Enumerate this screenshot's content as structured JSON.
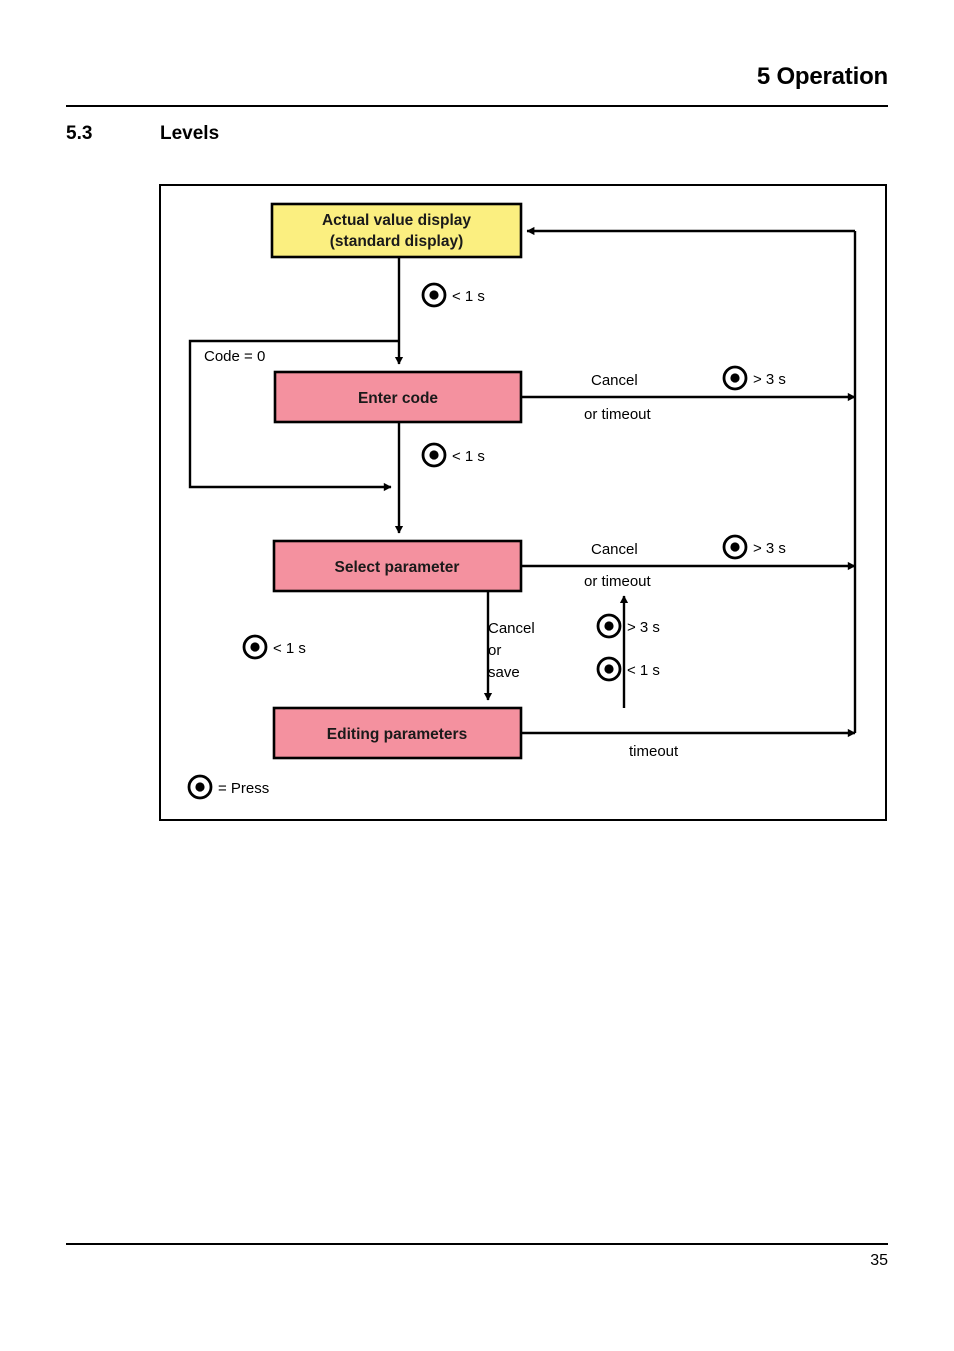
{
  "header": {
    "chapter_title": "5 Operation"
  },
  "section": {
    "number": "5.3",
    "title": "Levels"
  },
  "diagram": {
    "nodes": {
      "actual_value": {
        "line1": "Actual value display",
        "line2": "(standard display)",
        "color": "#FBEF80"
      },
      "enter_code": {
        "label": "Enter code",
        "color": "#F4919F"
      },
      "select_parameter": {
        "label": "Select parameter",
        "color": "#F4919F"
      },
      "editing_parameters": {
        "label": "Editing parameters",
        "color": "#F4919F"
      }
    },
    "edge_labels": {
      "press_short_1": "< 1 s",
      "press_short_2": "< 1 s",
      "press_short_3": "< 1 s",
      "press_short_4": "< 1 s",
      "press_long_1": "> 3 s",
      "press_long_2": "> 3 s",
      "press_long_3": "> 3 s",
      "code_zero": "Code = 0",
      "cancel_1": "Cancel",
      "or_timeout_1": "or timeout",
      "cancel_2": "Cancel",
      "or_timeout_2": "or timeout",
      "cancel_or_save_1": "Cancel",
      "cancel_or_save_2": "or",
      "cancel_or_save_3": "save",
      "timeout": "timeout"
    },
    "legend": {
      "text": "= Press",
      "icon": "press-button-icon"
    }
  },
  "footer": {
    "page_number": "35"
  }
}
